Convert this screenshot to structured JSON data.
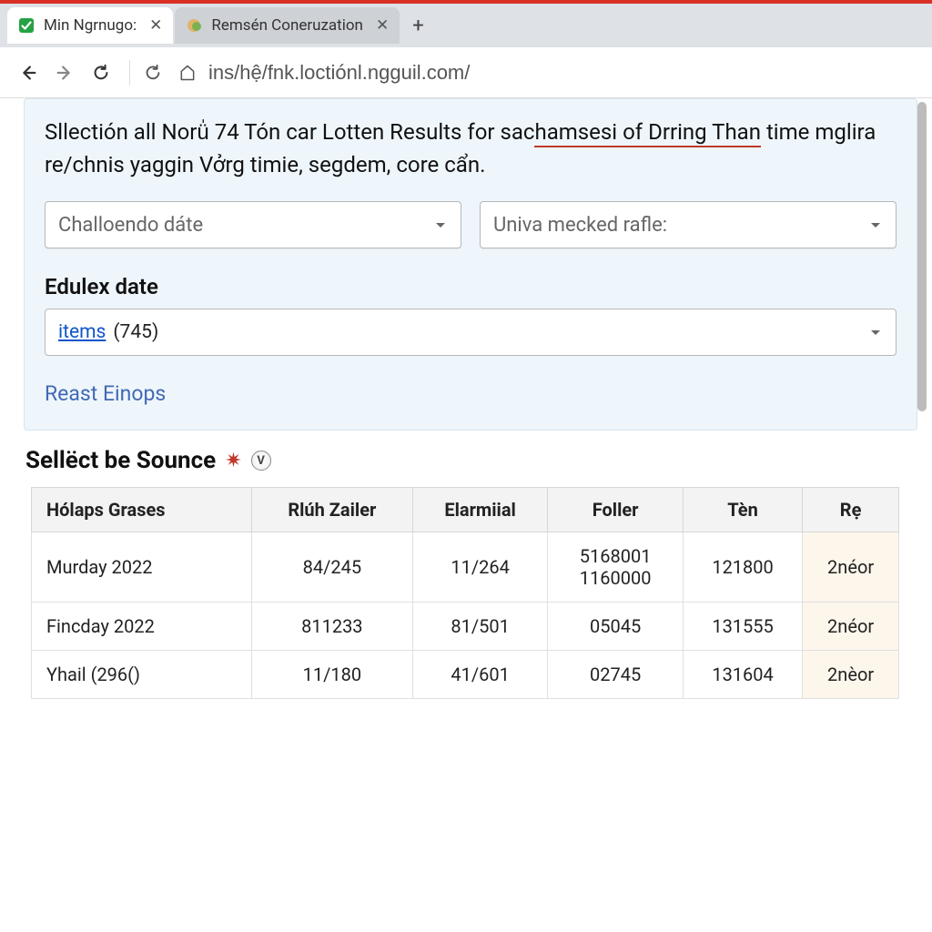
{
  "browser": {
    "tabs": [
      {
        "title": "Min Ngrnugo:",
        "active": true
      },
      {
        "title": "Remsén Coneruzation",
        "active": false
      }
    ],
    "url": "ins/hệ/fnk.loctiónl.ngguil.com/"
  },
  "panel": {
    "description_pre": "Sllectión all Norü̍ 74 Tón car Lotten Results for sac",
    "description_link": "hamsesi of Drring Than",
    "description_post": " time mglira re/chnis yaggin Vởrg timie, segdem, core cẩn.",
    "select1_placeholder": "Challoendo dáte",
    "select2_placeholder": "Univa mecked rafle:",
    "field_label": "Edulex date",
    "items_link_label": "items",
    "items_count": "(745)",
    "reset_label": "Reast Einops"
  },
  "section": {
    "title": "Sellëct be Sounce",
    "badge": "V"
  },
  "table": {
    "headers": [
      "Hólaps Grases",
      "Rlúh Zailer",
      "Elarmiial",
      "Foller",
      "Tèn",
      "Rẹ"
    ],
    "rows": [
      {
        "c0": "Murday 2022",
        "c1": "84/245",
        "c2": "11/264",
        "c3": "5168001\n1160000",
        "c4": "121800",
        "c5": "2néor"
      },
      {
        "c0": "Fincday 2022",
        "c1": "811233",
        "c2": "81/501",
        "c3": "05045",
        "c4": "131555",
        "c5": "2néor"
      },
      {
        "c0": "Yhail (296()",
        "c1": "11/180",
        "c2": "41/601",
        "c3": "02745",
        "c4": "131604",
        "c5": "2nèor"
      }
    ]
  }
}
